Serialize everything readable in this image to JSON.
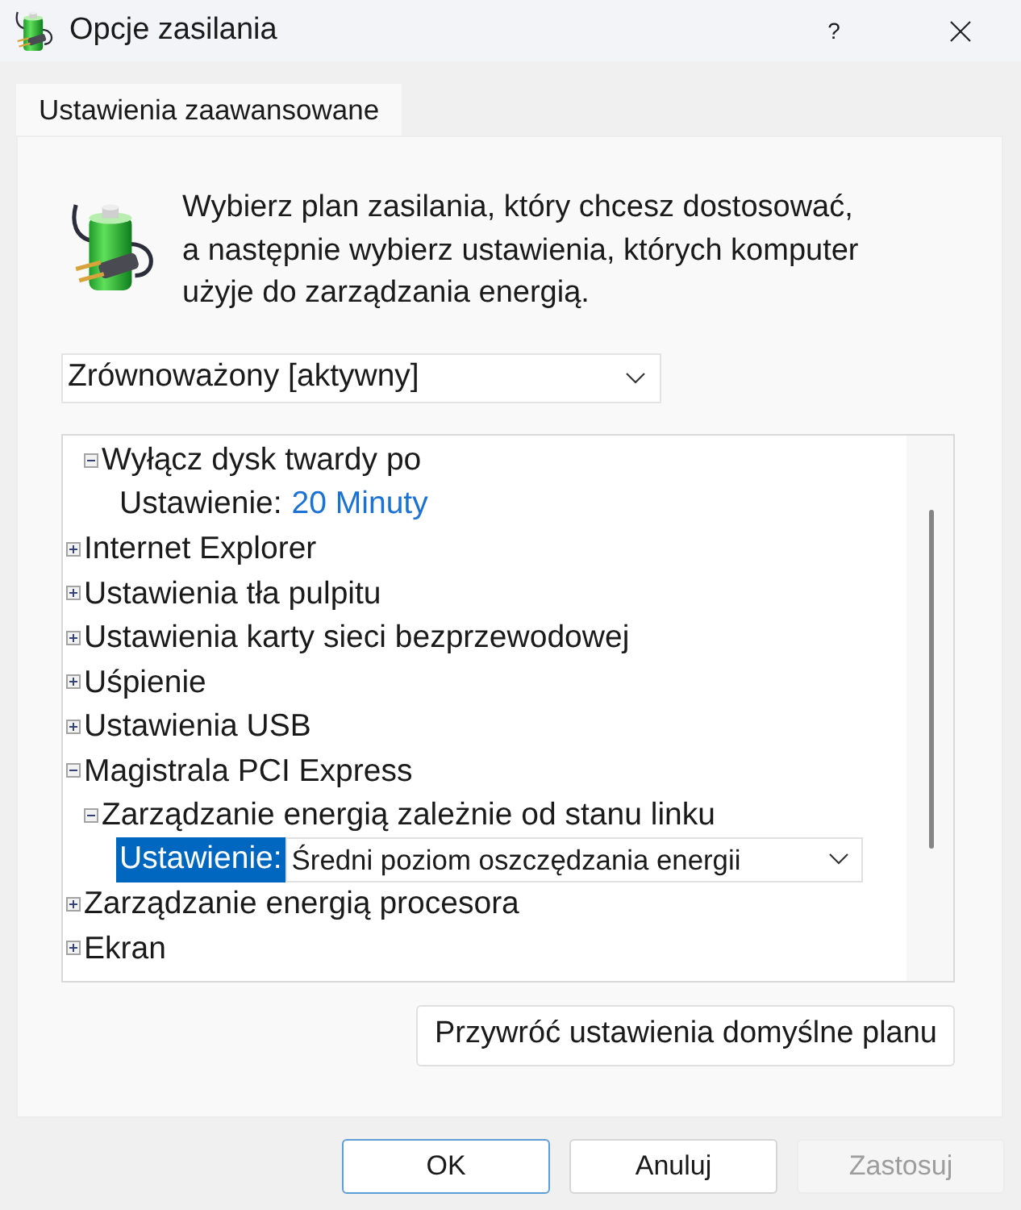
{
  "window": {
    "title": "Opcje zasilania",
    "help_button": "?"
  },
  "tabs": [
    {
      "label": "Ustawienia zaawansowane",
      "selected": true
    }
  ],
  "description_lines": [
    "Wybierz plan zasilania, który chcesz dostosować,",
    "a następnie wybierz ustawienia, których komputer",
    "użyje do zarządzania energią."
  ],
  "plan_select": {
    "value": "Zrównoważony [aktywny]"
  },
  "settings_tree": {
    "items": [
      {
        "kind": "group",
        "children": [
          {
            "kind": "group",
            "label": "Wyłącz dysk twardy po",
            "expanded": true,
            "selected": false,
            "children": [
              {
                "kind": "setting",
                "label": "Ustawienie:",
                "value": "20 Minuty",
                "selected": false
              }
            ]
          }
        ]
      },
      {
        "kind": "group",
        "label": "Internet Explorer",
        "expanded": false,
        "selected": false
      },
      {
        "kind": "group",
        "label": "Ustawienia tła pulpitu",
        "expanded": false,
        "selected": false
      },
      {
        "kind": "group",
        "label": "Ustawienia karty sieci bezprzewodowej",
        "expanded": false,
        "selected": false
      },
      {
        "kind": "group",
        "label": "Uśpienie",
        "expanded": false,
        "selected": false
      },
      {
        "kind": "group",
        "label": "Ustawienia USB",
        "expanded": false,
        "selected": false
      },
      {
        "kind": "group",
        "label": "Magistrala PCI Express",
        "expanded": true,
        "selected": false,
        "children": [
          {
            "kind": "group",
            "label": "Zarządzanie energią zależnie od stanu linku",
            "expanded": true,
            "selected": false,
            "children": [
              {
                "kind": "setting",
                "label": "Ustawienie:",
                "value": "Średni poziom oszczędzania energii",
                "selected": true
              }
            ]
          }
        ]
      },
      {
        "kind": "group",
        "label": "Zarządzanie energią procesora",
        "expanded": false,
        "selected": false
      },
      {
        "kind": "group",
        "label": "Ekran",
        "expanded": false,
        "selected": false
      }
    ]
  },
  "restore_button": "Przywróć ustawienia domyślne planu",
  "buttons": [
    {
      "label": "OK",
      "default": true,
      "disabled": false
    },
    {
      "label": "Anuluj",
      "default": false,
      "disabled": false
    },
    {
      "label": "Zastosuj",
      "default": false,
      "disabled": true
    }
  ]
}
